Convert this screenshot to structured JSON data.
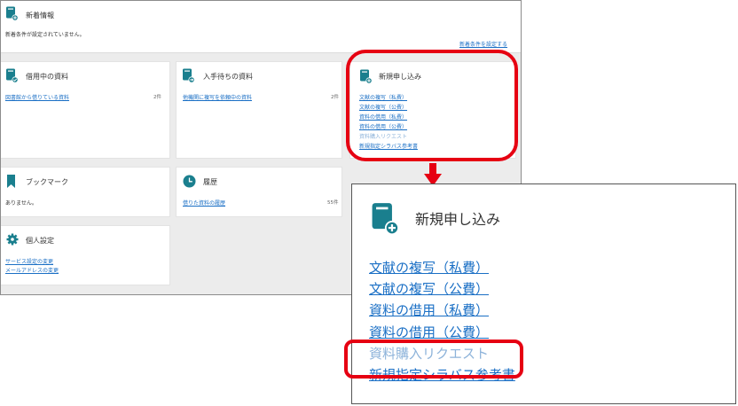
{
  "news": {
    "title": "新着情報",
    "message": "新着条件が設定されていません。",
    "setting_link": "新着条件を設定する"
  },
  "cards": {
    "borrowing": {
      "title": "借用中の資料",
      "link": "図書館から借りている資料",
      "count": "2件"
    },
    "waiting": {
      "title": "入手待ちの資料",
      "link": "他機関に複写を依頼中の資料",
      "count": "2件"
    },
    "request": {
      "title": "新規申し込み",
      "links": [
        "文献の複写（私費）",
        "文献の複写（公費）",
        "資料の借用（私費）",
        "資料の借用（公費）",
        "資料購入リクエスト",
        "新規指定シラバス参考書"
      ]
    },
    "bookmark": {
      "title": "ブックマーク",
      "message": "ありません。"
    },
    "history": {
      "title": "履歴",
      "link": "借りた資料の履歴",
      "count": "55件"
    },
    "settings": {
      "title": "個人設定",
      "links": [
        "サービス設定の変更",
        "メールアドレスの変更"
      ]
    }
  },
  "zoom": {
    "title": "新規申し込み",
    "links": [
      "文献の複写（私費）",
      "文献の複写（公費）",
      "資料の借用（私費）",
      "資料の借用（公費）",
      "資料購入リクエスト",
      "新規指定シラバス参考書"
    ]
  },
  "colors": {
    "accent": "#1a7f8e",
    "link": "#1a6fc5",
    "disabled_link": "#8db3da",
    "highlight": "#e60012"
  }
}
